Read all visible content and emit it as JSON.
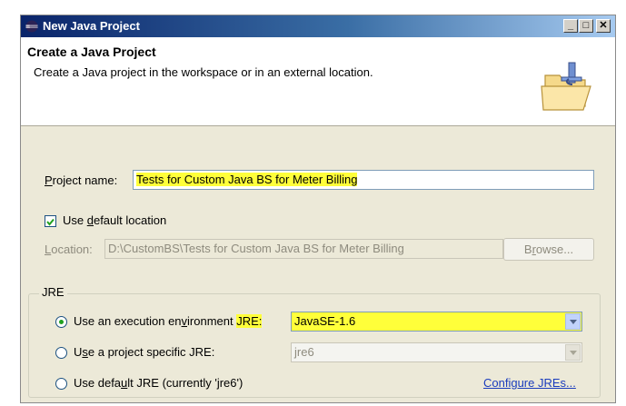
{
  "window": {
    "title": "New Java Project",
    "controls": {
      "minimize": "_",
      "maximize": "□",
      "close": "✕"
    }
  },
  "header": {
    "title": "Create a Java Project",
    "description": "Create a Java project in the workspace or in an external location.",
    "icon": "java-project-folder-icon"
  },
  "project": {
    "name_label_pre": "",
    "name_label_mn": "P",
    "name_label_post": "roject name:",
    "name_value": "Tests for Custom Java BS for Meter Billing",
    "use_default_pre": "Use ",
    "use_default_mn": "d",
    "use_default_post": "efault location",
    "use_default_checked": true,
    "location_label_mn": "L",
    "location_label_post": "ocation:",
    "location_value": "D:\\CustomBS\\Tests for Custom Java BS for Meter Billing",
    "browse_pre": "B",
    "browse_mn": "r",
    "browse_post": "owse..."
  },
  "jre": {
    "group_label": "JRE",
    "option_exec_pre": "Use an execution en",
    "option_exec_mn": "v",
    "option_exec_post": "ironment",
    "option_exec_jre": "JRE:",
    "option_exec_value": "JavaSE-1.6",
    "option_exec_checked": true,
    "option_specific_pre": "U",
    "option_specific_mn": "s",
    "option_specific_post": "e a project specific JRE:",
    "option_specific_value": "jre6",
    "option_default_pre": "Use defa",
    "option_default_mn": "u",
    "option_default_post": "lt JRE (currently 'jre6')",
    "configure_link": "Configure JREs..."
  },
  "colors": {
    "highlight": "#ffff3a",
    "titlebar": "#0a246a",
    "link": "#1b3dbd"
  }
}
